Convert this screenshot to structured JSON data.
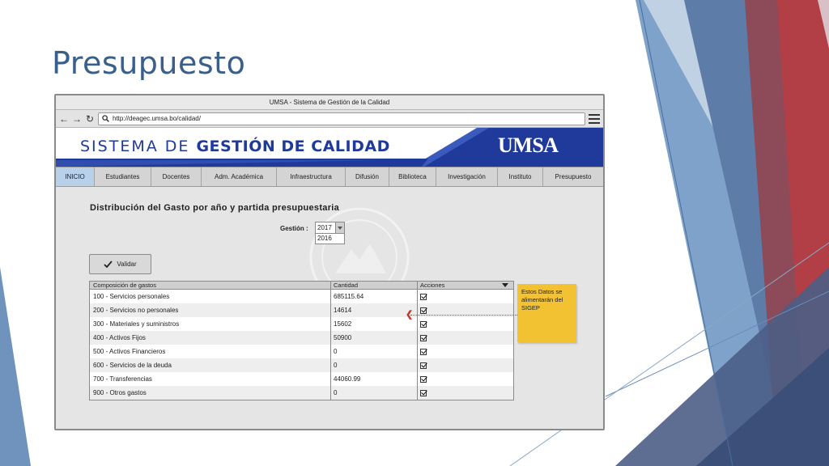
{
  "slide": {
    "title": "Presupuesto"
  },
  "browser": {
    "window_title": "UMSA - Sistema de Gestión de la Calidad",
    "url": "http://deagec.umsa.bo/calidad/"
  },
  "banner": {
    "title_light": "SISTEMA DE ",
    "title_bold": "GESTIÓN DE CALIDAD",
    "logo_text": "UMSA"
  },
  "menu": [
    {
      "label": "INICIO",
      "active": true
    },
    {
      "label": "Estudiantes"
    },
    {
      "label": "Docentes"
    },
    {
      "label": "Adm. Académica"
    },
    {
      "label": "Infraestructura"
    },
    {
      "label": "Difusión"
    },
    {
      "label": "Biblioteca"
    },
    {
      "label": "Investigación"
    },
    {
      "label": "Instituto"
    },
    {
      "label": "Presupuesto"
    }
  ],
  "main": {
    "heading": "Distribución del Gasto por año y partida presupuestaria",
    "gestion_label": "Gestión :",
    "gestion_selected": "2017",
    "gestion_option": "2016",
    "validate_label": "Validar",
    "table": {
      "headers": [
        "Composición de gastos",
        "Cantidad",
        "Acciones"
      ],
      "rows": [
        {
          "concept": "100 - Servicios personales",
          "amount": "685115.64",
          "checked": true
        },
        {
          "concept": "200 - Servicios no personales",
          "amount": "14614",
          "checked": true
        },
        {
          "concept": "300 - Materiales y suministros",
          "amount": "15602",
          "checked": true
        },
        {
          "concept": "400 - Activos Fijos",
          "amount": "50900",
          "checked": true
        },
        {
          "concept": "500 - Activos Financieros",
          "amount": "0",
          "checked": true
        },
        {
          "concept": "600 - Servicios de la deuda",
          "amount": "0",
          "checked": true
        },
        {
          "concept": "700 - Transferencias",
          "amount": "44060.99",
          "checked": true
        },
        {
          "concept": "900 - Otros gastos",
          "amount": "0",
          "checked": true
        }
      ]
    }
  },
  "note": {
    "text": "Estos Datos se alimentarán del SIGEP"
  },
  "colors": {
    "title": "#3a5f8a",
    "banner_blue": "#1f3a9a",
    "active_tab": "#b9d0ea",
    "sticky": "#f2c233",
    "arrow": "#c0392b"
  }
}
